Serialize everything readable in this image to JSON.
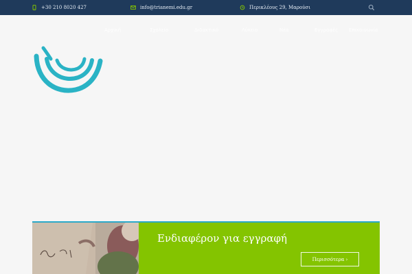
{
  "topbar": {
    "phone": "+30 210 8020 427",
    "email": "info@trianemi.edu.gr",
    "address": "Περικλέους 29, Μαρούσι"
  },
  "nav": {
    "items": [
      {
        "label": "Αρχική"
      },
      {
        "label": "Σχολείο"
      },
      {
        "label": "Διδακτικό"
      },
      {
        "label": "Λύκειο"
      },
      {
        "label": "Νέα"
      },
      {
        "label": "Εγγραφές"
      },
      {
        "label": "Επικοινωνία"
      }
    ]
  },
  "cta": {
    "title": "Ενδιαφέρον για εγγραφή",
    "button_label": "Περισσότερα ›"
  },
  "colors": {
    "topbar_bg": "#1f3a5b",
    "accent_green": "#84c400",
    "accent_teal": "#2aa9c9"
  },
  "icons": {
    "phone": "phone-icon",
    "mail": "mail-icon",
    "clock": "clock-icon",
    "search": "search-icon"
  }
}
